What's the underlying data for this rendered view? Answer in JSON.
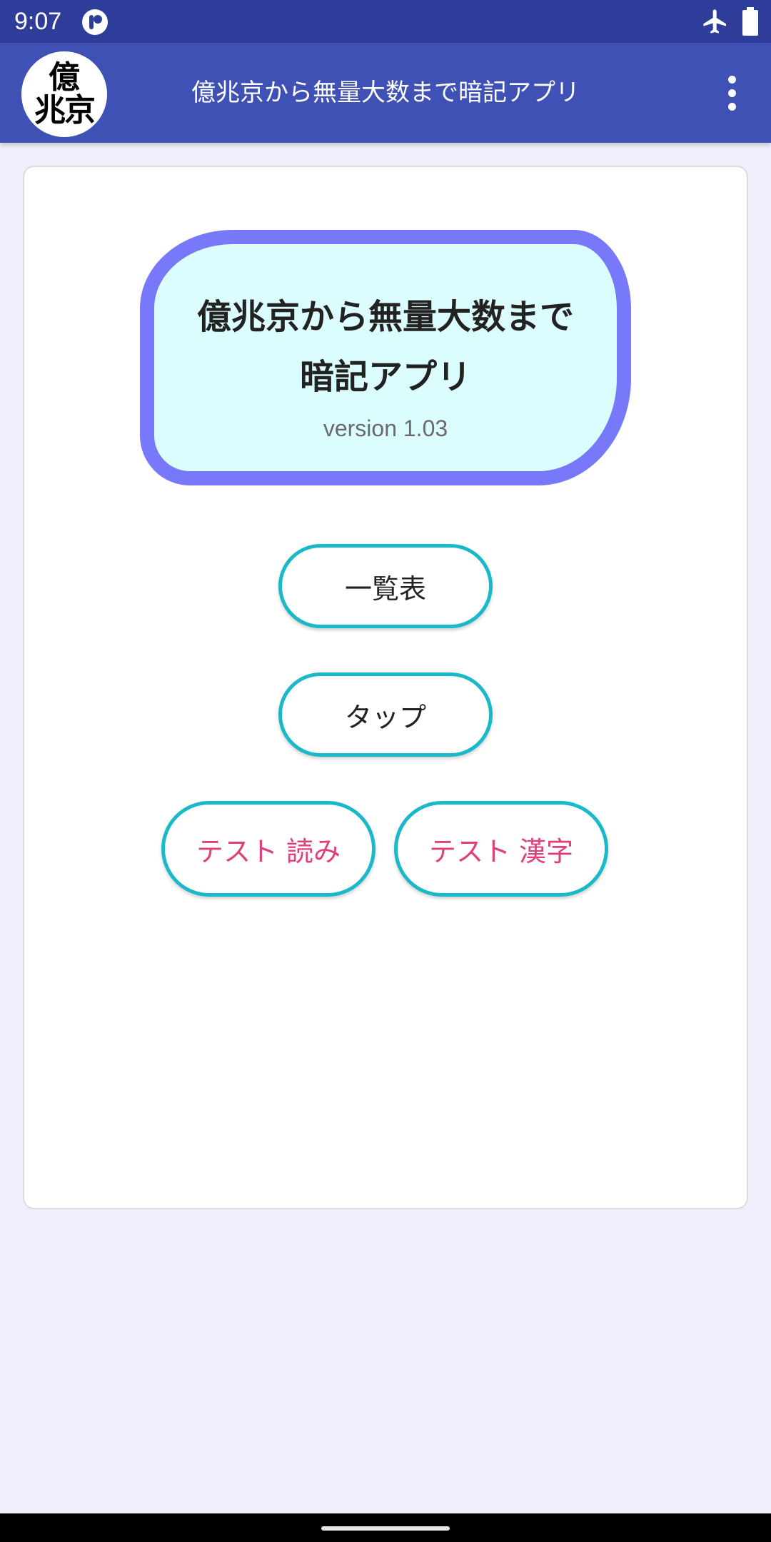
{
  "status_bar": {
    "time": "9:07",
    "icons": [
      "app-notification-icon",
      "airplane-mode-icon",
      "battery-icon"
    ]
  },
  "app_bar": {
    "logo_line1": "億",
    "logo_line2": "兆京",
    "title": "億兆京から無量大数まで暗記アプリ",
    "menu_icon": "more-vert-icon"
  },
  "main": {
    "title_line1": "億兆京から無量大数まで",
    "title_line2": "暗記アプリ",
    "version": "version  1.03",
    "buttons": {
      "list": "一覧表",
      "tap": "タップ",
      "test_reading": "テスト 読み",
      "test_kanji": "テスト 漢字"
    }
  },
  "colors": {
    "status_bar": "#2f3d9a",
    "app_bar": "#3f51b5",
    "background": "#eeeefc",
    "panel_fill": "#dcfdfd",
    "panel_border": "#7878fa",
    "button_border": "#1ab9c9",
    "test_text": "#e0407a"
  }
}
